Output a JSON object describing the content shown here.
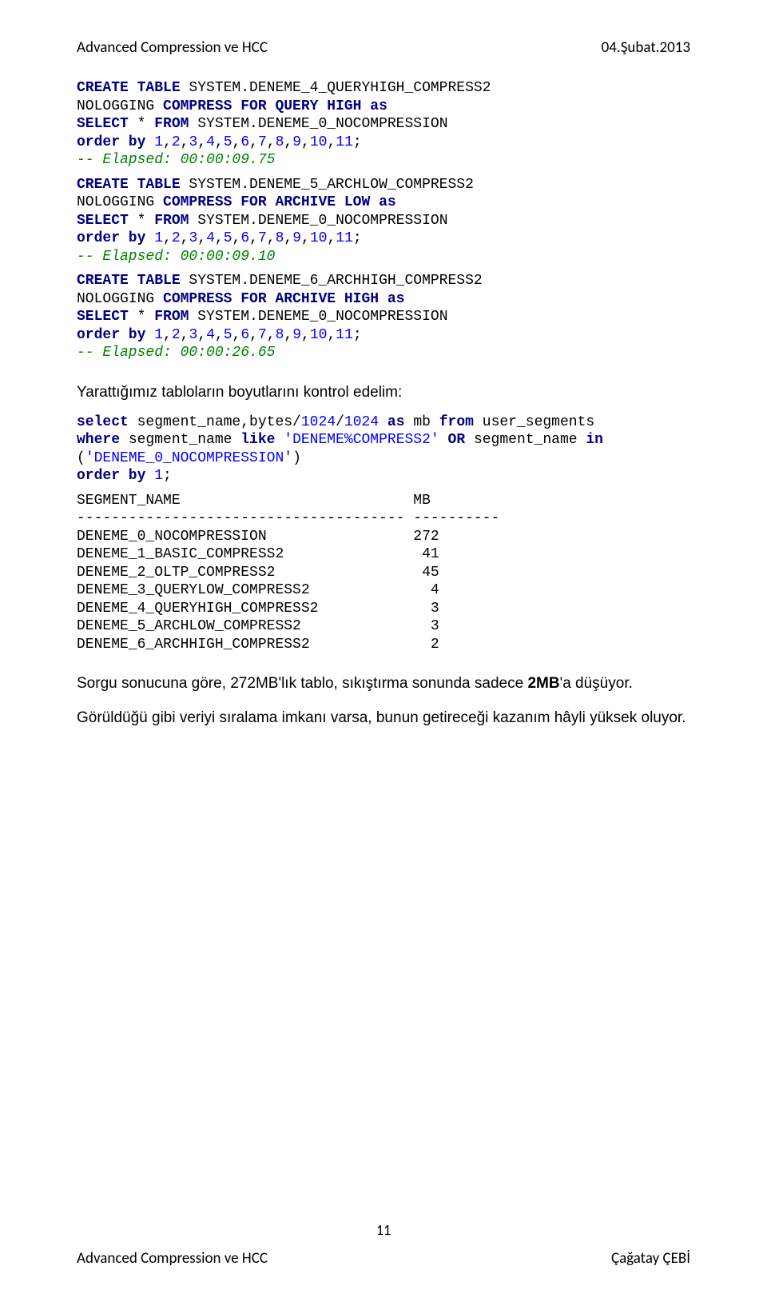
{
  "header": {
    "left": "Advanced Compression ve HCC",
    "right": "04.Şubat.2013"
  },
  "codeBlock1": {
    "l1a": "CREATE TABLE",
    "l1b": " SYSTEM.DENEME_4_QUERYHIGH_COMPRESS2",
    "l2a": "NOLOGGING ",
    "l2b": "COMPRESS FOR QUERY HIGH as",
    "l3a": "SELECT",
    "l3b": " * ",
    "l3c": "FROM",
    "l3d": " SYSTEM.DENEME_0_NOCOMPRESSION",
    "l4a": "order by ",
    "l4b": "1",
    "l4c": ",",
    "l4d": "2",
    "l4e": ",",
    "l4f": "3",
    "l4g": ",",
    "l4h": "4",
    "l4i": ",",
    "l4j": "5",
    "l4k": ",",
    "l4l": "6",
    "l4m": ",",
    "l4n": "7",
    "l4o": ",",
    "l4p": "8",
    "l4q": ",",
    "l4r": "9",
    "l4s": ",",
    "l4t": "10",
    "l4u": ",",
    "l4v": "11",
    "l4w": ";",
    "l5": "-- Elapsed: 00:00:09.75"
  },
  "codeBlock2": {
    "l1a": "CREATE TABLE",
    "l1b": " SYSTEM.DENEME_5_ARCHLOW_COMPRESS2",
    "l2a": "NOLOGGING ",
    "l2b": "COMPRESS FOR ARCHIVE LOW as",
    "l3a": "SELECT",
    "l3b": " * ",
    "l3c": "FROM",
    "l3d": " SYSTEM.DENEME_0_NOCOMPRESSION",
    "l4a": "order by ",
    "l4b": "1",
    "l4c": ",",
    "l4d": "2",
    "l4e": ",",
    "l4f": "3",
    "l4g": ",",
    "l4h": "4",
    "l4i": ",",
    "l4j": "5",
    "l4k": ",",
    "l4l": "6",
    "l4m": ",",
    "l4n": "7",
    "l4o": ",",
    "l4p": "8",
    "l4q": ",",
    "l4r": "9",
    "l4s": ",",
    "l4t": "10",
    "l4u": ",",
    "l4v": "11",
    "l4w": ";",
    "l5": "-- Elapsed: 00:00:09.10"
  },
  "codeBlock3": {
    "l1a": "CREATE TABLE",
    "l1b": " SYSTEM.DENEME_6_ARCHHIGH_COMPRESS2",
    "l2a": "NOLOGGING ",
    "l2b": "COMPRESS FOR ARCHIVE HIGH as",
    "l3a": "SELECT",
    "l3b": " * ",
    "l3c": "FROM",
    "l3d": " SYSTEM.DENEME_0_NOCOMPRESSION",
    "l4a": "order by ",
    "l4b": "1",
    "l4c": ",",
    "l4d": "2",
    "l4e": ",",
    "l4f": "3",
    "l4g": ",",
    "l4h": "4",
    "l4i": ",",
    "l4j": "5",
    "l4k": ",",
    "l4l": "6",
    "l4m": ",",
    "l4n": "7",
    "l4o": ",",
    "l4p": "8",
    "l4q": ",",
    "l4r": "9",
    "l4s": ",",
    "l4t": "10",
    "l4u": ",",
    "l4v": "11",
    "l4w": ";",
    "l5": "-- Elapsed: 00:00:26.65"
  },
  "paragraph1": "Yarattığımız tabloların boyutlarını kontrol edelim:",
  "query": {
    "l1a": "select",
    "l1b": " segment_name,bytes/",
    "l1c": "1024",
    "l1d": "/",
    "l1e": "1024",
    "l1f": " ",
    "l1g": "as",
    "l1h": " mb ",
    "l1i": "from",
    "l1j": " user_segments",
    "l2a": "where",
    "l2b": " segment_name ",
    "l2c": "like",
    "l2d": " ",
    "l2e": "'DENEME%COMPRESS2'",
    "l2f": " ",
    "l2g": "OR",
    "l2h": " segment_name ",
    "l2i": "in",
    "l3a": "(",
    "l3b": "'DENEME_0_NOCOMPRESSION'",
    "l3c": ")",
    "l4a": "order by ",
    "l4b": "1",
    "l4c": ";"
  },
  "results": {
    "h1": "SEGMENT_NAME                           MB",
    "h2": "-------------------------------------- ----------",
    "r1": "DENEME_0_NOCOMPRESSION                 272",
    "r2": "DENEME_1_BASIC_COMPRESS2                41",
    "r3": "DENEME_2_OLTP_COMPRESS2                 45",
    "r4": "DENEME_3_QUERYLOW_COMPRESS2              4",
    "r5": "DENEME_4_QUERYHIGH_COMPRESS2             3",
    "r6": "DENEME_5_ARCHLOW_COMPRESS2               3",
    "r7": "DENEME_6_ARCHHIGH_COMPRESS2              2"
  },
  "paragraph2": {
    "t1": "Sorgu sonucuna göre, 272MB'lık tablo, sıkıştırma sonunda sadece ",
    "t2": "2MB",
    "t3": "'a düşüyor."
  },
  "paragraph3": "Görüldüğü gibi veriyi sıralama imkanı varsa, bunun getireceği kazanım hâyli yüksek oluyor.",
  "pageNumber": "11",
  "footer": {
    "left": "Advanced Compression ve HCC",
    "right": "Çağatay ÇEBİ"
  }
}
